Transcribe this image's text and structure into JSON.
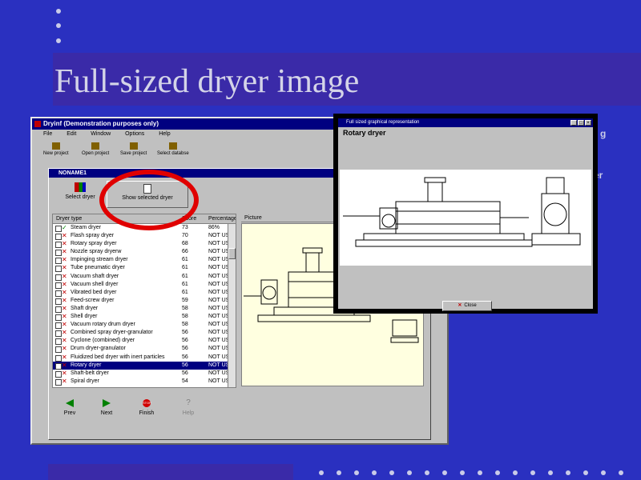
{
  "slide": {
    "title": "Full-sized dryer image",
    "side_fragment_1": "g",
    "side_fragment_2": "er"
  },
  "app": {
    "title": "Dryinf (Demonstration purposes only)",
    "menu": [
      "File",
      "Edit",
      "Window",
      "Options",
      "Help"
    ],
    "toolbar": [
      "New project",
      "Open project",
      "Save project",
      "Select databse"
    ]
  },
  "inner_window": {
    "title": "NONAME1",
    "select_dryer_label": "Select dryer",
    "show_selected_label": "Show selected dryer",
    "columns": [
      "Dryer type",
      "Score",
      "Percentage",
      "Picture"
    ],
    "rows": [
      {
        "name": "Steam dryer",
        "score": "73",
        "pct": "86%",
        "ok": true
      },
      {
        "name": "Flash spray dryer",
        "score": "70",
        "pct": "NOT US."
      },
      {
        "name": "Rotary spray dryer",
        "score": "68",
        "pct": "NOT US."
      },
      {
        "name": "Nozzle spray dryerw",
        "score": "66",
        "pct": "NOT US."
      },
      {
        "name": "Impinging stream dryer",
        "score": "61",
        "pct": "NOT US."
      },
      {
        "name": "Tube pneumatic dryer",
        "score": "61",
        "pct": "NOT US."
      },
      {
        "name": "Vacuum shaft dryer",
        "score": "61",
        "pct": "NOT US."
      },
      {
        "name": "Vacuum shell dryer",
        "score": "61",
        "pct": "NOT US."
      },
      {
        "name": "Vibrated bed dryer",
        "score": "61",
        "pct": "NOT US."
      },
      {
        "name": "Feed-screw dryer",
        "score": "59",
        "pct": "NOT US."
      },
      {
        "name": "Shaft dryer",
        "score": "58",
        "pct": "NOT US."
      },
      {
        "name": "Shell dryer",
        "score": "58",
        "pct": "NOT US."
      },
      {
        "name": "Vacuum rotary drum dryer",
        "score": "58",
        "pct": "NOT US."
      },
      {
        "name": "Combined spray dryer-granulator",
        "score": "56",
        "pct": "NOT US."
      },
      {
        "name": "Cyclone (combined) dryer",
        "score": "56",
        "pct": "NOT US."
      },
      {
        "name": "Drum dryer-granulator",
        "score": "56",
        "pct": "NOT US."
      },
      {
        "name": "Fluidized bed dryer with inert particles",
        "score": "56",
        "pct": "NOT US."
      },
      {
        "name": "Rotary dryer",
        "score": "56",
        "pct": "NOT US.",
        "selected": true
      },
      {
        "name": "Shaft-belt dryer",
        "score": "56",
        "pct": "NOT US."
      },
      {
        "name": "Spiral dryer",
        "score": "54",
        "pct": "NOT US."
      }
    ],
    "nav": [
      "Prev",
      "Next",
      "Finish",
      "Help"
    ],
    "stop_label": "STOP"
  },
  "popup": {
    "title": "Full sized graphical representation",
    "label": "Rotary dryer",
    "close_label": "Close"
  },
  "colors": {
    "slide_bg": "#2a30c0",
    "band": "#3a2aa8",
    "ring": "#e00000",
    "win_title": "#000080"
  }
}
